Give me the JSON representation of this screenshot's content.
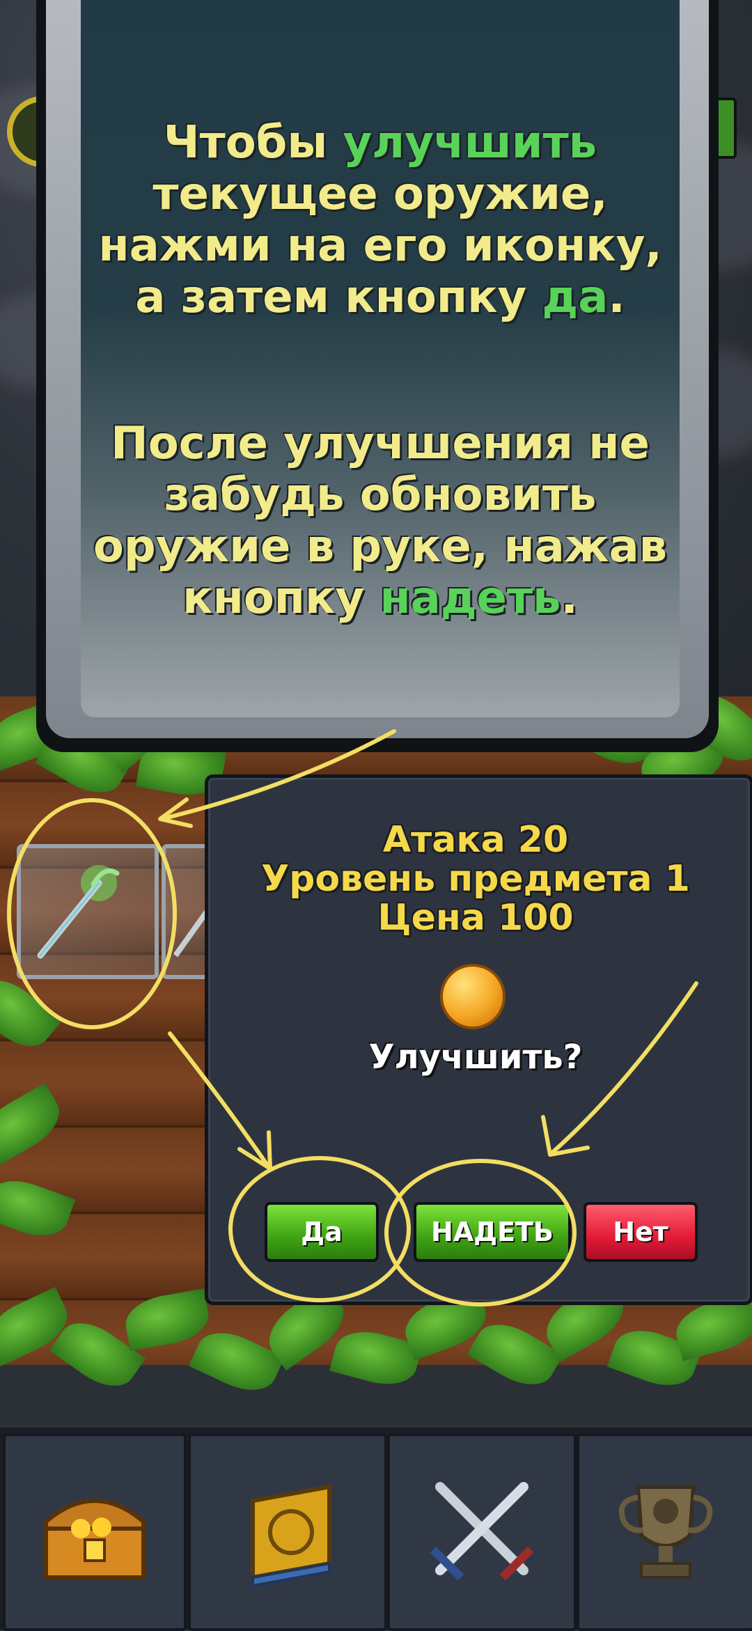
{
  "tutorial": {
    "para1": {
      "part1": "Чтобы ",
      "part2": "улучшить",
      "part3": " текущее оружие, нажми на его иконку, а затем кнопку ",
      "part4": "да",
      "part5": "."
    },
    "para2": {
      "part1": "После улучшения не забудь обновить оружие в руке, нажав кнопку ",
      "part2": "надеть",
      "part3": "."
    }
  },
  "dialog": {
    "attack": "Атака 20",
    "level": "Уровень предмета 1",
    "price": "Цена 100",
    "question": "Улучшить?",
    "yes_label": "Да",
    "equip_label": "НАДЕТЬ",
    "no_label": "Нет"
  },
  "nav": {
    "items": [
      {
        "icon": "treasure-chest-icon"
      },
      {
        "icon": "book-icon"
      },
      {
        "icon": "crossed-swords-icon"
      },
      {
        "icon": "trophy-icon"
      }
    ]
  },
  "colors": {
    "text_yellow": "#f1eb8c",
    "highlight_green": "#59d25a",
    "gold": "#f5d94a",
    "button_green": "#3fa314",
    "button_red": "#e41a36",
    "annotation_yellow": "#f3de63"
  }
}
